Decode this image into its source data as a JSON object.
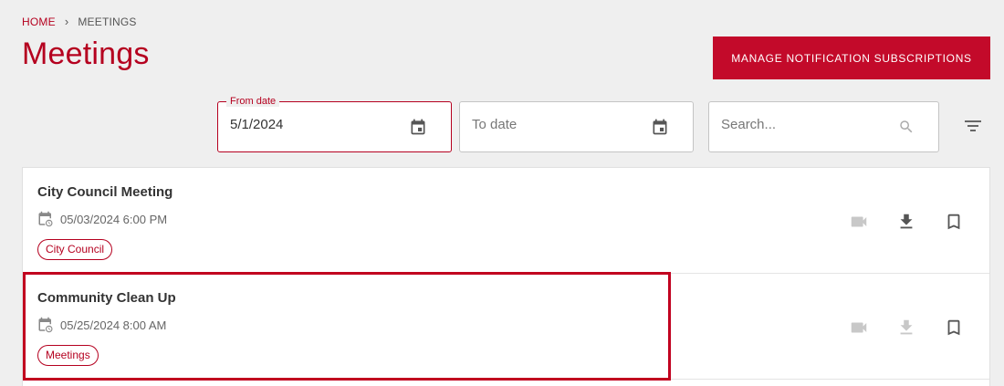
{
  "breadcrumb": {
    "home": "HOME",
    "separator": "›",
    "current": "MEETINGS"
  },
  "page_title": "Meetings",
  "manage_button": "MANAGE NOTIFICATION SUBSCRIPTIONS",
  "filters": {
    "from_date": {
      "label": "From date",
      "value": "5/1/2024"
    },
    "to_date": {
      "placeholder": "To date"
    },
    "search": {
      "placeholder": "Search..."
    }
  },
  "meetings": [
    {
      "title": "City Council Meeting",
      "datetime": "05/03/2024 6:00 PM",
      "tag": "City Council"
    },
    {
      "title": "Community Clean Up",
      "datetime": "05/25/2024 8:00 AM",
      "tag": "Meetings"
    }
  ],
  "colors": {
    "brand": "#c30a2a",
    "text": "#333333",
    "muted": "#666666",
    "disabled_icon": "#c8c8c8"
  },
  "icons": {
    "calendar": "calendar-icon",
    "search": "search-icon",
    "filter": "filter-icon",
    "video": "video-icon",
    "download": "download-icon",
    "bookmark": "bookmark-icon"
  }
}
